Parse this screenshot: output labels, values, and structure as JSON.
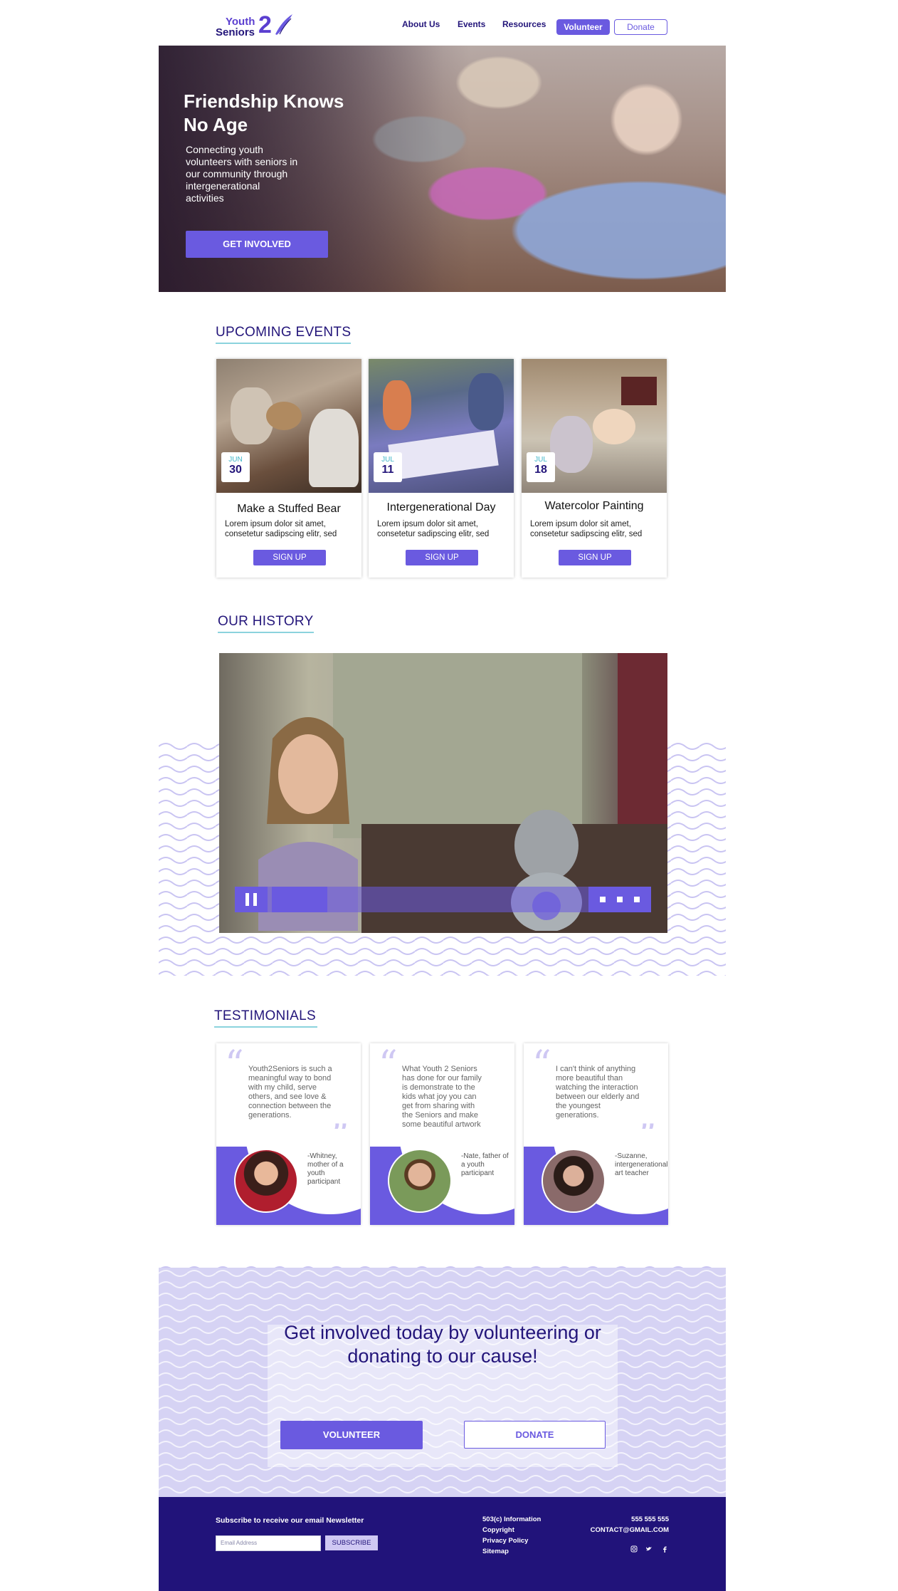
{
  "brand": {
    "logo_line1": "Youth",
    "logo_line2": "Seniors",
    "logo_mark": "2"
  },
  "nav": {
    "items": [
      "About Us",
      "Events",
      "Resources"
    ],
    "volunteer_label": "Volunteer",
    "donate_label": "Donate"
  },
  "hero": {
    "title": "Friendship Knows No Age",
    "subtitle": "Connecting youth volunteers with seniors in our community through intergenerational activities",
    "cta_label": "GET INVOLVED"
  },
  "events": {
    "title": "UPCOMING EVENTS",
    "cards": [
      {
        "month": "JUN",
        "day": "30",
        "title": "Make a Stuffed Bear",
        "desc": "Lorem ipsum dolor sit amet, consetetur sadipscing elitr, sed",
        "button": "SIGN UP"
      },
      {
        "month": "JUL",
        "day": "11",
        "title": "Intergenerational Day",
        "desc": "Lorem ipsum dolor sit amet, consetetur sadipscing elitr, sed",
        "button": "SIGN UP"
      },
      {
        "month": "JUL",
        "day": "18",
        "title": "Watercolor Painting",
        "desc": "Lorem ipsum dolor sit amet, consetetur sadipscing elitr, sed",
        "button": "SIGN UP"
      }
    ]
  },
  "history": {
    "title": "OUR HISTORY",
    "video": {
      "state": "playing",
      "progress": 0.18
    }
  },
  "testimonials": {
    "title": "TESTIMONIALS",
    "items": [
      {
        "quote": "Youth2Seniors is such a meaningful way to bond with my child, serve others, and see love & connection between the generations.",
        "author": "-Whitney, mother of a youth participant"
      },
      {
        "quote": "What Youth 2 Seniors has done for our family is demonstrate to the kids what joy you can get from sharing with the Seniors and make some beautiful artwork with them.",
        "author": "-Nate, father of a youth participant"
      },
      {
        "quote": "I can't think of anything more beautiful than watching the interaction between our elderly and the youngest generations.",
        "author": "-Suzanne, intergenerational art teacher"
      }
    ]
  },
  "cta": {
    "heading": "Get involved today by volunteering or donating to our cause!",
    "volunteer_label": "VOLUNTEER",
    "donate_label": "DONATE"
  },
  "footer": {
    "newsletter_label": "Subscribe to receive our email Newsletter",
    "email_placeholder": "Email Address",
    "subscribe_label": "SUBSCRIBE",
    "links": [
      "503(c) Information",
      "Copyright",
      "Privacy Policy",
      "Sitemap"
    ],
    "phone": "555 555 555",
    "email": "CONTACT@GMAIL.COM",
    "social_icons": [
      "instagram-icon",
      "twitter-icon",
      "facebook-icon"
    ]
  },
  "colors": {
    "accent": "#6a5ae0",
    "navy": "#21137a",
    "teal": "#8bd3dd",
    "lavender": "#d6d3f4"
  }
}
